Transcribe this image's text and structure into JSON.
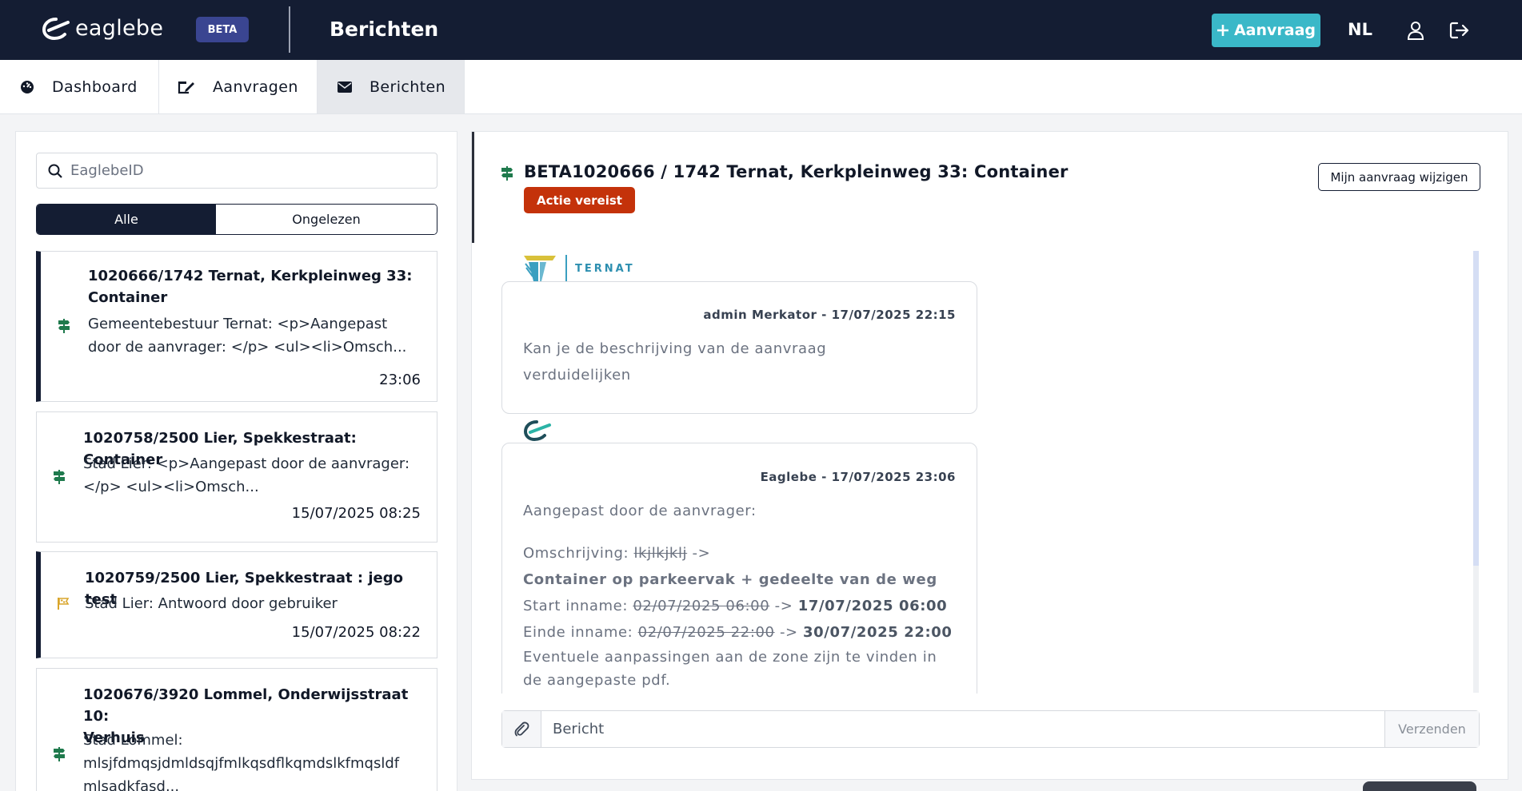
{
  "topbar": {
    "logo_text": "eaglebe",
    "beta": "BETA",
    "title": "Berichten",
    "new_request": "Aanvraag",
    "lang": "NL"
  },
  "nav": {
    "tabs": [
      {
        "label": "Dashboard",
        "icon": "gauge-icon"
      },
      {
        "label": "Aanvragen",
        "icon": "signature-icon"
      },
      {
        "label": "Berichten",
        "icon": "envelope-icon",
        "active": true
      }
    ]
  },
  "list": {
    "search_placeholder": "EaglebeID",
    "filters": {
      "all": "Alle",
      "unread": "Ongelezen"
    },
    "items": [
      {
        "title_l1": "1020666/1742 Ternat, Kerkpleinweg 33:",
        "title_l2": "Container",
        "preview_l1": "Gemeentebestuur Ternat: <p>Aangepast",
        "preview_l2": "door de aanvrager: </p> <ul><li>Omsch...",
        "time": "23:06",
        "icon": "signpost-icon",
        "unread": true
      },
      {
        "title_l1": "1020758/2500 Lier, Spekkestraat: Container",
        "preview_l1": "Stad Lier: <p>Aangepast door de aanvrager:",
        "preview_l2": "</p> <ul><li>Omsch...",
        "time": "15/07/2025 08:25",
        "icon": "signpost-icon",
        "unread": false
      },
      {
        "title_l1": "1020759/2500 Lier, Spekkestraat : jego test",
        "preview_l1": "Stad Lier: Antwoord door gebruiker",
        "time": "15/07/2025 08:22",
        "icon": "flag-icon",
        "unread": true
      },
      {
        "title_l1": "1020676/3920 Lommel, Onderwijsstraat 10:",
        "title_l2": "Verhuis",
        "preview_l1": "Stad Lommel:",
        "preview_l2": "mlsjfdmqsjdmldsqjfmlkqsdflkqmdslkfmqsldf",
        "preview_l3": "mlsadkfasd...",
        "icon": "signpost-icon",
        "unread": false
      }
    ]
  },
  "conversation": {
    "title": "BETA1020666 / 1742 Ternat, Kerkpleinweg 33: Container",
    "status": "Actie vereist",
    "edit_button": "Mijn aanvraag wijzigen",
    "messages": [
      {
        "sender_logo_text": "TERNAT",
        "meta": "admin Merkator - 17/07/2025 22:15",
        "body_l1": "Kan je de beschrijving van de aanvraag",
        "body_l2": "verduidelijken"
      },
      {
        "meta": "Eaglebe - 17/07/2025 23:06",
        "intro": "Aangepast door de aanvrager:",
        "desc_label": "Omschrijving:",
        "desc_old": "lkjlkjklj",
        "arrow": "->",
        "desc_new": "Container op parkeervak + gedeelte van de weg",
        "start_label": "Start inname:",
        "start_old": "02/07/2025 06:00",
        "start_new": "17/07/2025 06:00",
        "end_label": "Einde inname:",
        "end_old": "02/07/2025 22:00",
        "end_new": "30/07/2025 22:00",
        "note_l1": "Eventuele aanpassingen aan de zone zijn te vinden in",
        "note_l2": "de aangepaste pdf."
      }
    ],
    "composer": {
      "placeholder": "Bericht",
      "send": "Verzenden"
    }
  },
  "colors": {
    "navy": "#141d33",
    "accent": "#3ab8c8",
    "danger": "#c4320a",
    "signpost_green": "#1f7a4d",
    "flag_yellow": "#d9a52b"
  }
}
